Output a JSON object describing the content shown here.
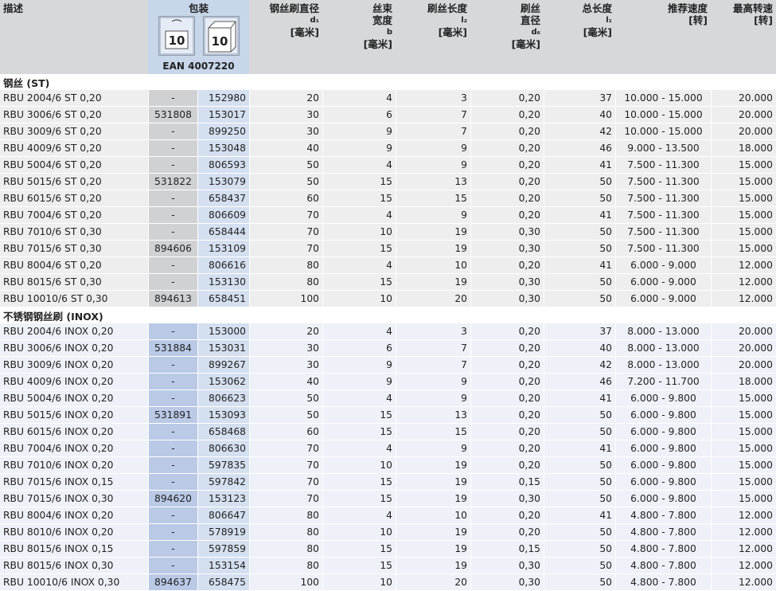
{
  "header": {
    "desc": "描述",
    "pack": "包装",
    "box1_qty": "10",
    "box2_qty": "10",
    "ean": "EAN 4007220",
    "diam_label": "钢丝刷直径",
    "diam_sym": "d₁",
    "diam_unit": "[毫米]",
    "width_label1": "丝束",
    "width_label2": "宽度",
    "width_sym": "b",
    "width_unit": "[毫米]",
    "len_label": "刷丝长度",
    "len_sym": "l₂",
    "len_unit": "[毫米]",
    "wire_label1": "刷丝",
    "wire_label2": "直径",
    "wire_sym": "d₆",
    "wire_unit": "[毫米]",
    "total_label": "总长度",
    "total_sym": "l₁",
    "total_unit": "[毫米]",
    "rec_label": "推荐速度",
    "rec_unit": "[转]",
    "max_label": "最高转速",
    "max_unit": "[转]"
  },
  "sections": [
    {
      "title": "钢丝 (ST)",
      "rows": [
        [
          "RBU 2004/6 ST 0,20",
          "-",
          "152980",
          "20",
          "4",
          "3",
          "0,20",
          "37",
          "10.000 - 15.000",
          "20.000"
        ],
        [
          "RBU 3006/6 ST 0,20",
          "531808",
          "153017",
          "30",
          "6",
          "7",
          "0,20",
          "40",
          "10.000 - 15.000",
          "20.000"
        ],
        [
          "RBU 3009/6 ST 0,20",
          "-",
          "899250",
          "30",
          "9",
          "7",
          "0,20",
          "42",
          "10.000 - 15.000",
          "20.000"
        ],
        [
          "RBU 4009/6 ST 0,20",
          "-",
          "153048",
          "40",
          "9",
          "9",
          "0,20",
          "46",
          "9.000 - 13.500",
          "18.000"
        ],
        [
          "RBU 5004/6 ST 0,20",
          "-",
          "806593",
          "50",
          "4",
          "9",
          "0,20",
          "41",
          "7.500 - 11.300",
          "15.000"
        ],
        [
          "RBU 5015/6 ST 0,20",
          "531822",
          "153079",
          "50",
          "15",
          "13",
          "0,20",
          "50",
          "7.500 - 11.300",
          "15.000"
        ],
        [
          "RBU 6015/6 ST 0,20",
          "-",
          "658437",
          "60",
          "15",
          "15",
          "0,20",
          "50",
          "7.500 - 11.300",
          "15.000"
        ],
        [
          "RBU 7004/6 ST 0,20",
          "-",
          "806609",
          "70",
          "4",
          "9",
          "0,20",
          "41",
          "7.500 - 11.300",
          "15.000"
        ],
        [
          "RBU 7010/6 ST 0,30",
          "-",
          "658444",
          "70",
          "10",
          "19",
          "0,30",
          "50",
          "7.500 - 11.300",
          "15.000"
        ],
        [
          "RBU 7015/6 ST 0,30",
          "894606",
          "153109",
          "70",
          "15",
          "19",
          "0,30",
          "50",
          "7.500 - 11.300",
          "15.000"
        ],
        [
          "RBU 8004/6 ST 0,20",
          "-",
          "806616",
          "80",
          "4",
          "10",
          "0,20",
          "41",
          "6.000 - 9.000",
          "12.000"
        ],
        [
          "RBU 8015/6 ST 0,30",
          "-",
          "153130",
          "80",
          "15",
          "19",
          "0,30",
          "50",
          "6.000 - 9.000",
          "12.000"
        ],
        [
          "RBU 10010/6 ST 0,30",
          "894613",
          "658451",
          "100",
          "10",
          "20",
          "0,30",
          "50",
          "6.000 - 9.000",
          "12.000"
        ]
      ]
    },
    {
      "title": "不锈钢钢丝刷 (INOX)",
      "rows": [
        [
          "RBU 2004/6 INOX 0,20",
          "-",
          "153000",
          "20",
          "4",
          "3",
          "0,20",
          "37",
          "8.000 - 13.000",
          "20.000"
        ],
        [
          "RBU 3006/6 INOX 0,20",
          "531884",
          "153031",
          "30",
          "6",
          "7",
          "0,20",
          "40",
          "8.000 - 13.000",
          "20.000"
        ],
        [
          "RBU 3009/6 INOX 0,20",
          "-",
          "899267",
          "30",
          "9",
          "7",
          "0,20",
          "42",
          "8.000 - 13.000",
          "20.000"
        ],
        [
          "RBU 4009/6 INOX 0,20",
          "-",
          "153062",
          "40",
          "9",
          "9",
          "0,20",
          "46",
          "7.200 - 11.700",
          "18.000"
        ],
        [
          "RBU 5004/6 INOX 0,20",
          "-",
          "806623",
          "50",
          "4",
          "9",
          "0,20",
          "41",
          "6.000 - 9.800",
          "15.000"
        ],
        [
          "RBU 5015/6 INOX 0,20",
          "531891",
          "153093",
          "50",
          "15",
          "13",
          "0,20",
          "50",
          "6.000 - 9.800",
          "15.000"
        ],
        [
          "RBU 6015/6 INOX 0,20",
          "-",
          "658468",
          "60",
          "15",
          "15",
          "0,20",
          "50",
          "6.000 - 9.800",
          "15.000"
        ],
        [
          "RBU 7004/6 INOX 0,20",
          "-",
          "806630",
          "70",
          "4",
          "9",
          "0,20",
          "41",
          "6.000 - 9.800",
          "15.000"
        ],
        [
          "RBU 7010/6 INOX 0,20",
          "-",
          "597835",
          "70",
          "10",
          "19",
          "0,20",
          "50",
          "6.000 - 9.800",
          "15.000"
        ],
        [
          "RBU 7015/6 INOX 0,15",
          "-",
          "597842",
          "70",
          "15",
          "19",
          "0,15",
          "50",
          "6.000 - 9.800",
          "15.000"
        ],
        [
          "RBU 7015/6 INOX 0,30",
          "894620",
          "153123",
          "70",
          "15",
          "19",
          "0,30",
          "50",
          "6.000 - 9.800",
          "15.000"
        ],
        [
          "RBU 8004/6 INOX 0,20",
          "-",
          "806647",
          "80",
          "4",
          "10",
          "0,20",
          "41",
          "4.800 - 7.800",
          "12.000"
        ],
        [
          "RBU 8010/6 INOX 0,20",
          "-",
          "578919",
          "80",
          "10",
          "19",
          "0,20",
          "50",
          "4.800 - 7.800",
          "12.000"
        ],
        [
          "RBU 8015/6 INOX 0,15",
          "-",
          "597859",
          "80",
          "15",
          "19",
          "0,15",
          "50",
          "4.800 - 7.800",
          "12.000"
        ],
        [
          "RBU 8015/6 INOX 0,30",
          "-",
          "153154",
          "80",
          "15",
          "19",
          "0,30",
          "50",
          "4.800 - 7.800",
          "12.000"
        ],
        [
          "RBU 10010/6 INOX 0,30",
          "894637",
          "658475",
          "100",
          "10",
          "20",
          "0,30",
          "50",
          "4.800 - 7.800",
          "12.000"
        ]
      ]
    }
  ]
}
